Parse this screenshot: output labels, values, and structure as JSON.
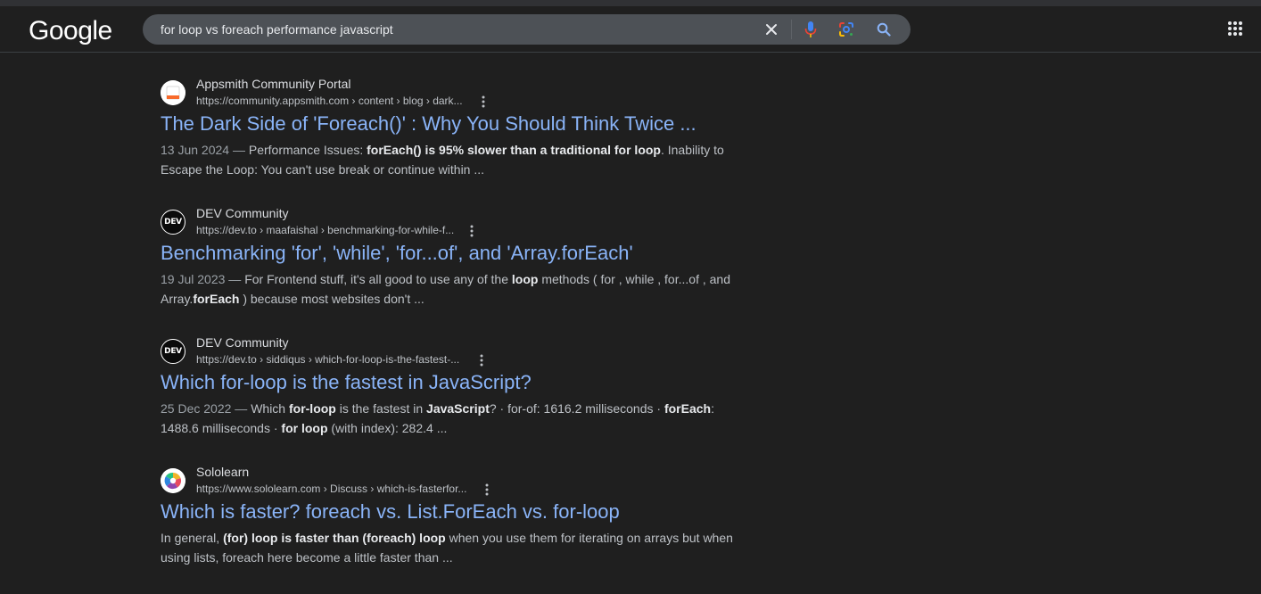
{
  "logo": "Google",
  "search": {
    "query": "for loop vs foreach performance javascript"
  },
  "icons": {
    "clear": "close-icon",
    "voice": "microphone-icon",
    "lens": "lens-icon",
    "search": "search-icon",
    "apps": "apps-grid-icon",
    "more": "more-vert-icon"
  },
  "colors": {
    "link": "#8ab4f8",
    "background": "#1f1f1f",
    "searchbox": "#4d5156"
  },
  "results": [
    {
      "site": "Appsmith Community Portal",
      "url": "https://community.appsmith.com › content › blog › dark...",
      "favicon": "appsmith-favicon",
      "title": "The Dark Side of 'Foreach()' : Why You Should Think Twice ...",
      "date": "13 Jun 2024",
      "snippet": [
        {
          "t": "Performance Issues: ",
          "b": false
        },
        {
          "t": "forEach() is 95% slower than a traditional for loop",
          "b": true
        },
        {
          "t": ". Inability to Escape the Loop: You can't use break or continue within ...",
          "b": false
        }
      ]
    },
    {
      "site": "DEV Community",
      "url": "https://dev.to › maafaishal › benchmarking-for-while-f...",
      "favicon": "dev-favicon",
      "favicon_text": "DEV",
      "title": "Benchmarking 'for', 'while', 'for...of', and 'Array.forEach'",
      "date": "19 Jul 2023",
      "snippet": [
        {
          "t": "For Frontend stuff, it's all good to use any of the ",
          "b": false
        },
        {
          "t": "loop",
          "b": true
        },
        {
          "t": " methods ( for , while , for...of , and Array.",
          "b": false
        },
        {
          "t": "forEach",
          "b": true
        },
        {
          "t": " ) because most websites don't ...",
          "b": false
        }
      ]
    },
    {
      "site": "DEV Community",
      "url": "https://dev.to › siddiqus › which-for-loop-is-the-fastest-...",
      "favicon": "dev-favicon",
      "favicon_text": "DEV",
      "title": "Which for-loop is the fastest in JavaScript?",
      "date": "25 Dec 2022",
      "snippet": [
        {
          "t": "Which ",
          "b": false
        },
        {
          "t": "for-loop",
          "b": true
        },
        {
          "t": " is the fastest in ",
          "b": false
        },
        {
          "t": "JavaScript",
          "b": true
        },
        {
          "t": "? · for-of: 1616.2 milliseconds · ",
          "b": false
        },
        {
          "t": "forEach",
          "b": true
        },
        {
          "t": ": 1488.6 milliseconds · ",
          "b": false
        },
        {
          "t": "for loop",
          "b": true
        },
        {
          "t": " (with index): 282.4 ...",
          "b": false
        }
      ]
    },
    {
      "site": "Sololearn",
      "url": "https://www.sololearn.com › Discuss › which-is-fasterfor...",
      "favicon": "sololearn-favicon",
      "title": "Which is faster? foreach vs. List.ForEach vs. for-loop",
      "date": "",
      "snippet": [
        {
          "t": "In general, ",
          "b": false
        },
        {
          "t": "(for) loop is faster than (foreach) loop",
          "b": true
        },
        {
          "t": " when you use them for iterating on arrays but when using lists, foreach here become a little faster than ...",
          "b": false
        }
      ]
    }
  ]
}
